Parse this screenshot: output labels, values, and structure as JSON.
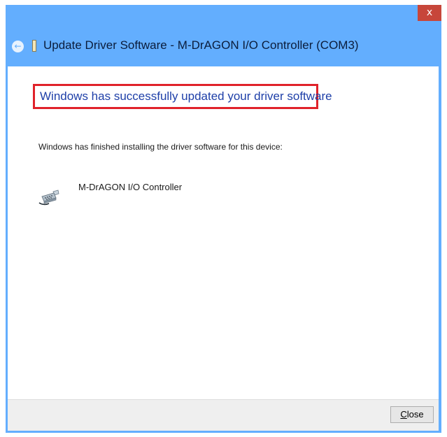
{
  "window": {
    "title": "Update Driver Software - M-DrAGON I/O Controller (COM3)",
    "close_glyph": "x",
    "back_glyph": "←"
  },
  "main": {
    "heading": "Windows has successfully updated your driver software",
    "info_text": "Windows has finished installing the driver software for this device:",
    "device_name": "M-DrAGON I/O Controller",
    "device_icon": "serial-port-connector-icon"
  },
  "footer": {
    "close_mnemonic": "C",
    "close_rest": "lose"
  },
  "colors": {
    "titlebar": "#63aefe",
    "close_button_bg": "#c7463a",
    "heading_text": "#1e3fa8",
    "highlight_border": "#e0222a"
  }
}
